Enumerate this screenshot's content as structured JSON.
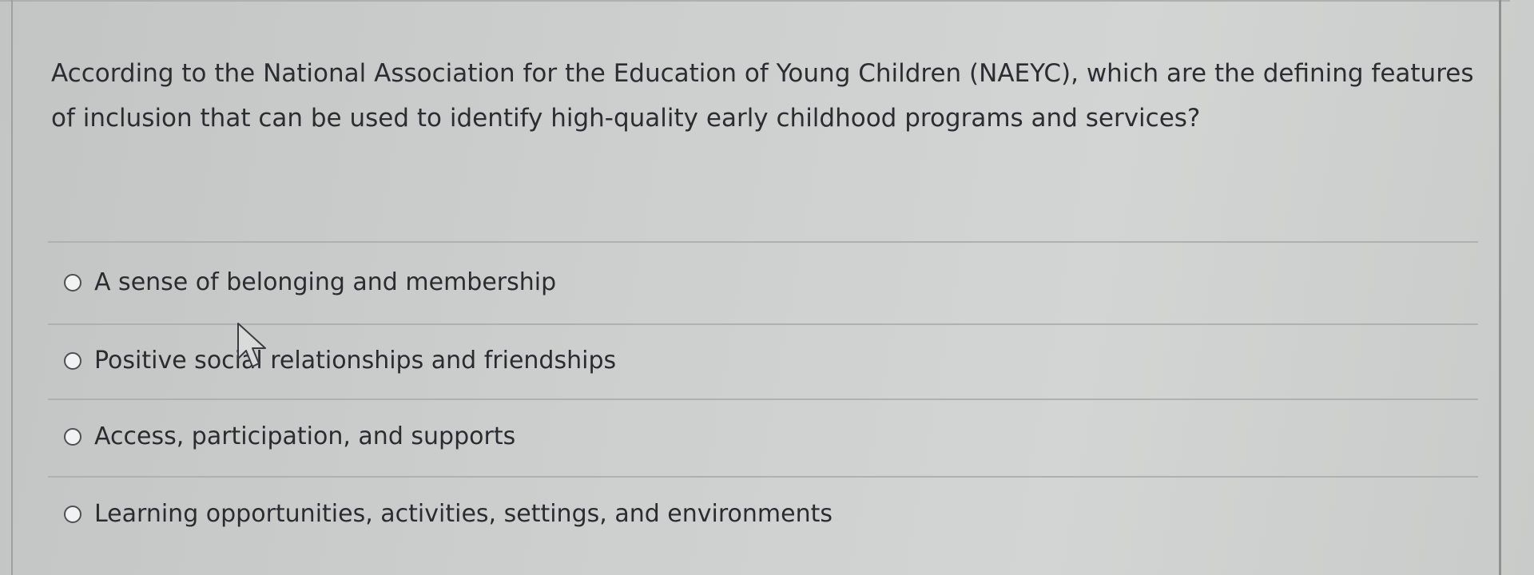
{
  "question": {
    "text": "According to the National Association for the Education of Young Children (NAEYC), which are the defining features of inclusion that can be used to identify high-quality early childhood programs and services?"
  },
  "options": [
    {
      "label": "A sense of belonging and membership",
      "selected": false
    },
    {
      "label": "Positive social relationships and friendships",
      "selected": false
    },
    {
      "label": "Access, participation, and supports",
      "selected": false
    },
    {
      "label": "Learning opportunities, activities, settings, and environments",
      "selected": false
    }
  ],
  "icons": {
    "radio": "radio-unselected-icon",
    "cursor": "mouse-pointer-icon"
  },
  "colors": {
    "background": "#cdcfcf",
    "text": "#2b2e31",
    "divider": "#aeb1b2"
  }
}
